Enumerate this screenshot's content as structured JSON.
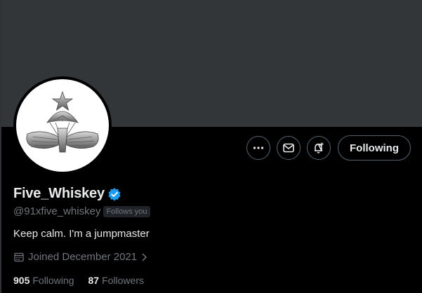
{
  "profile": {
    "display_name": "Five_Whiskey",
    "handle": "@91xfive_whiskey",
    "follows_you": "Follows you",
    "bio": "Keep calm. I'm a jumpmaster",
    "joined": "Joined December 2021",
    "verified_color": "#1d9bf0"
  },
  "actions": {
    "more_icon": "more-horizontal-icon",
    "message_icon": "mail-icon",
    "notify_icon": "bell-plus-icon",
    "following_label": "Following"
  },
  "stats": {
    "following_count": "905",
    "following_label": "Following",
    "followers_count": "87",
    "followers_label": "Followers"
  },
  "colors": {
    "background": "#000000",
    "banner": "#333639",
    "text_primary": "#e7e9ea",
    "text_secondary": "#71767b",
    "border": "#536471"
  }
}
